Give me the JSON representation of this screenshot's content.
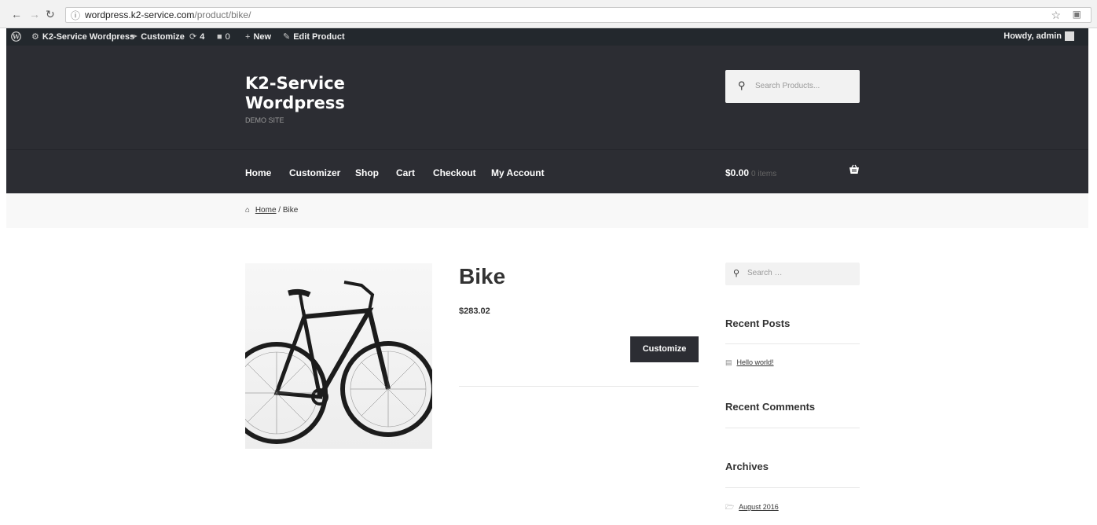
{
  "browser": {
    "back_icon": "back-arrow-icon",
    "forward_icon": "forward-arrow-icon",
    "reload_icon": "reload-icon",
    "url_domain": "wordpress.k2-service.com",
    "url_path": "/product/bike/"
  },
  "admin_bar": {
    "site_name": "K2-Service Wordpress",
    "customize": "Customize",
    "updates": "4",
    "comments": "0",
    "new": "New",
    "edit": "Edit Product",
    "howdy": "Howdy, admin"
  },
  "header": {
    "title_line1": "K2-Service",
    "title_line2": "Wordpress",
    "description": "DEMO SITE",
    "search_placeholder": "Search Products..."
  },
  "nav": {
    "items": [
      "Home",
      "Customizer",
      "Shop",
      "Cart",
      "Checkout",
      "My Account"
    ],
    "cart_amount": "$0.00",
    "cart_items": "0 items"
  },
  "breadcrumb": {
    "home": "Home",
    "separator": "/ Bike"
  },
  "product": {
    "title": "Bike",
    "price": "$283.02",
    "button": "Customize"
  },
  "sidebar": {
    "search_placeholder": "Search …",
    "recent_posts_title": "Recent Posts",
    "post_link": "Hello world!",
    "recent_comments_title": "Recent Comments",
    "archives_title": "Archives",
    "archive_link": "August 2016"
  }
}
